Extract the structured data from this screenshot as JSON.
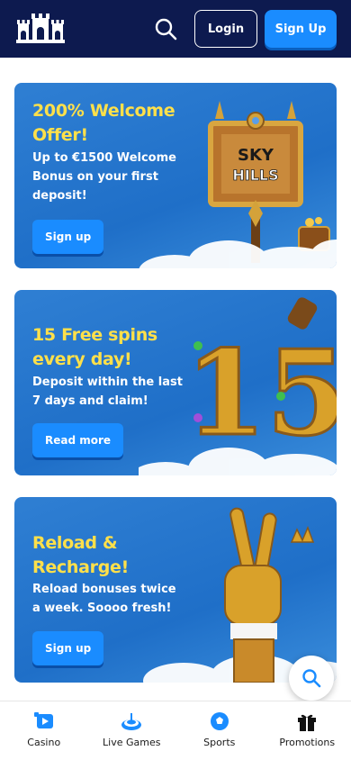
{
  "header": {
    "logo_icon": "castle-logo-icon",
    "search_icon": "search-icon",
    "login_label": "Login",
    "signup_label": "Sign Up"
  },
  "promos": [
    {
      "title": "200% Welcome Offer!",
      "description": "Up to €1500 Welcome Bonus on your first deposit!",
      "button_label": "Sign up",
      "art_sign_text_line1": "SKY",
      "art_sign_text_line2": "HILLS"
    },
    {
      "title": "15 Free spins every day!",
      "description": "Deposit within the last 7 days and claim!",
      "button_label": "Read more",
      "art_number": "15"
    },
    {
      "title": "Reload & Recharge!",
      "description": "Reload bonuses twice a week. Soooo fresh!",
      "button_label": "Sign up"
    }
  ],
  "nav": [
    {
      "label": "Casino",
      "icon": "casino-icon"
    },
    {
      "label": "Live Games",
      "icon": "live-games-icon"
    },
    {
      "label": "Sports",
      "icon": "sports-icon"
    },
    {
      "label": "Promotions",
      "icon": "gift-icon"
    }
  ],
  "colors": {
    "header_bg": "#0d1a4f",
    "accent_blue": "#1a8cff",
    "title_yellow": "#ffe04a",
    "card_blue": "#2f7fd3"
  }
}
